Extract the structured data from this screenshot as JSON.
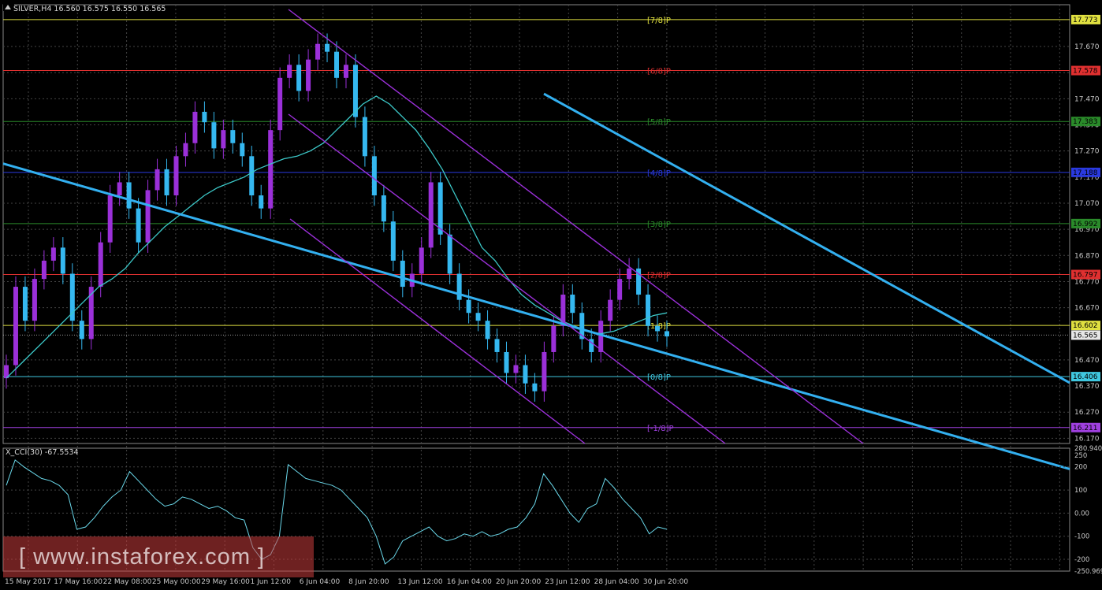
{
  "window": {
    "symbol_header": "SILVER,H4  16.560 16.575 16.550 16.565",
    "indicator_header": "X_CCI(30) -67.5534"
  },
  "watermark": {
    "text": "[ www.instaforex.com ]"
  },
  "colors": {
    "background": "#000000",
    "grid": "#444444",
    "bull": "#9b30d9",
    "bear": "#35b8f0",
    "ma": "#3cc8c8",
    "trend": "#33b0f0",
    "channel": "#9b30d9",
    "cci": "#6ad8ea"
  },
  "chart_data": [
    {
      "type": "candlestick",
      "title": "SILVER,H4",
      "ylim": [
        16.15,
        17.83
      ],
      "y_ticks": [
        "17.670",
        "17.570",
        "17.470",
        "17.370",
        "17.270",
        "17.170",
        "17.070",
        "16.970",
        "16.870",
        "16.770",
        "16.670",
        "16.565",
        "16.470",
        "16.370",
        "16.270",
        "16.170"
      ],
      "x_labels": [
        "15 May 2017",
        "17 May 16:00",
        "22 May 08:00",
        "25 May 00:00",
        "29 May 16:00",
        "1 Jun 12:00",
        "6 Jun 04:00",
        "8 Jun 20:00",
        "13 Jun 12:00",
        "16 Jun 04:00",
        "20 Jun 20:00",
        "23 Jun 12:00",
        "28 Jun 04:00",
        "30 Jun 20:00"
      ],
      "last_price": {
        "label": "16.565",
        "value": 16.565
      },
      "murrey_levels": [
        {
          "label": "[7/8]P",
          "price_label": "17.773",
          "value": 17.773,
          "color": "#e0e040"
        },
        {
          "label": "[6/8]P",
          "price_label": "17.578",
          "value": 17.578,
          "color": "#e03030"
        },
        {
          "label": "[5/8]P",
          "price_label": "17.383",
          "value": 17.383,
          "color": "#2a8a2a"
        },
        {
          "label": "[4/8]P",
          "price_label": "17.188",
          "value": 17.188,
          "color": "#2a3ae0"
        },
        {
          "label": "[3/8]P",
          "price_label": "16.992",
          "value": 16.992,
          "color": "#2a8a2a"
        },
        {
          "label": "[2/8]P",
          "price_label": "16.797",
          "value": 16.797,
          "color": "#e03030"
        },
        {
          "label": "[1/8]P",
          "price_label": "16.602",
          "value": 16.602,
          "color": "#e0e040"
        },
        {
          "label": "[0/8]P",
          "price_label": "16.406",
          "value": 16.406,
          "color": "#40c8e0"
        },
        {
          "label": "[-1/8]P",
          "price_label": "16.211",
          "value": 16.211,
          "color": "#a040e0"
        }
      ],
      "close_series": [
        16.45,
        16.75,
        16.62,
        16.78,
        16.85,
        16.9,
        16.8,
        16.62,
        16.55,
        16.75,
        16.92,
        17.1,
        17.15,
        17.05,
        16.92,
        17.12,
        17.2,
        17.1,
        17.25,
        17.3,
        17.42,
        17.38,
        17.28,
        17.35,
        17.3,
        17.25,
        17.1,
        17.05,
        17.35,
        17.55,
        17.6,
        17.5,
        17.62,
        17.68,
        17.65,
        17.55,
        17.6,
        17.4,
        17.25,
        17.1,
        17.0,
        16.85,
        16.75,
        16.8,
        16.9,
        17.15,
        16.95,
        16.8,
        16.7,
        16.65,
        16.62,
        16.55,
        16.5,
        16.42,
        16.45,
        16.38,
        16.35,
        16.5,
        16.6,
        16.72,
        16.65,
        16.55,
        16.5,
        16.62,
        16.7,
        16.78,
        16.82,
        16.72,
        16.6,
        16.58,
        16.56
      ],
      "ma_series": [
        16.4,
        16.45,
        16.5,
        16.55,
        16.6,
        16.65,
        16.7,
        16.75,
        16.78,
        16.82,
        16.88,
        16.93,
        16.98,
        17.02,
        17.06,
        17.1,
        17.13,
        17.15,
        17.17,
        17.2,
        17.22,
        17.24,
        17.25,
        17.27,
        17.3,
        17.35,
        17.4,
        17.45,
        17.48,
        17.45,
        17.4,
        17.35,
        17.28,
        17.2,
        17.1,
        17.0,
        16.9,
        16.85,
        16.78,
        16.72,
        16.68,
        16.65,
        16.62,
        16.6,
        16.58,
        16.57,
        16.58,
        16.6,
        16.62,
        16.64,
        16.65
      ],
      "y_values_note": "",
      "trendlines": [
        {
          "from": [
            "15 May 2017",
            17.22
          ],
          "to": [
            "30 Jun 20:00",
            16.52
          ],
          "type": "trend"
        },
        {
          "from": [
            "8 Jun 20:00",
            17.9
          ],
          "to": [
            "30 Jun 20:00",
            17.28
          ],
          "type": "trend"
        }
      ]
    },
    {
      "type": "line",
      "title": "X_CCI(30) -67.5534",
      "ylim": [
        -250.969,
        280.9405
      ],
      "y_ticks": [
        "280.9405",
        "250",
        "200",
        "100",
        "0.00",
        "-100",
        "-200",
        "-250.969"
      ],
      "values": [
        120,
        230,
        200,
        175,
        150,
        140,
        120,
        80,
        -70,
        -60,
        -20,
        30,
        70,
        100,
        180,
        140,
        100,
        60,
        30,
        40,
        70,
        60,
        40,
        20,
        30,
        10,
        -20,
        -30,
        -150,
        -200,
        -180,
        -100,
        210,
        180,
        150,
        140,
        130,
        120,
        100,
        60,
        20,
        -20,
        -100,
        -220,
        -190,
        -120,
        -100,
        -80,
        -60,
        -100,
        -120,
        -110,
        -90,
        -100,
        -80,
        -100,
        -90,
        -70,
        -60,
        -20,
        40,
        170,
        120,
        60,
        0,
        -40,
        20,
        40,
        150,
        110,
        60,
        20,
        -20,
        -90,
        -60,
        -70
      ]
    }
  ]
}
